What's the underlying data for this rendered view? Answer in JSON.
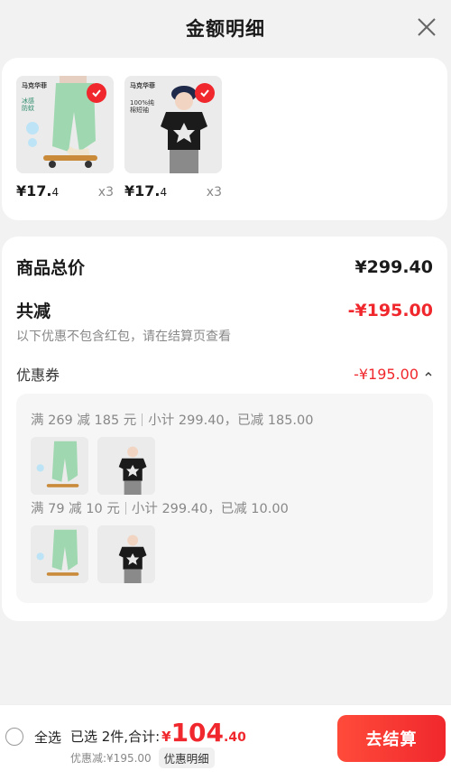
{
  "header": {
    "title": "金额明细"
  },
  "products": [
    {
      "brand": "马克华菲",
      "tag": "冰感防蚊",
      "price_int": "¥17.",
      "price_dec": "4",
      "qty": "x3"
    },
    {
      "brand": "马克华菲",
      "tag": "100%纯棉短袖",
      "price_int": "¥17.",
      "price_dec": "4",
      "qty": "x3"
    }
  ],
  "summary": {
    "goods_total_label": "商品总价",
    "goods_total_value": "¥299.40",
    "discount_label": "共减",
    "discount_value": "-¥195.00",
    "note": "以下优惠不包含红包，请在结算页查看"
  },
  "coupon": {
    "label": "优惠券",
    "value": "-¥195.00",
    "rules": [
      {
        "threshold": "满 269 减 185 元",
        "detail": "小计 299.40，已减 185.00"
      },
      {
        "threshold": "满 79 减 10 元",
        "detail": "小计 299.40，已减 10.00"
      }
    ]
  },
  "bottom_bar": {
    "select_all": "全选",
    "selected_text": "已选 2件,合计:",
    "currency": "¥",
    "total_int": "104",
    "total_dec": ".40",
    "discount_text": "优惠减:¥195.00",
    "detail_button": "优惠明细",
    "checkout_button": "去结算"
  },
  "colors": {
    "accent": "#f0282d",
    "background": "#f2f2f2"
  }
}
